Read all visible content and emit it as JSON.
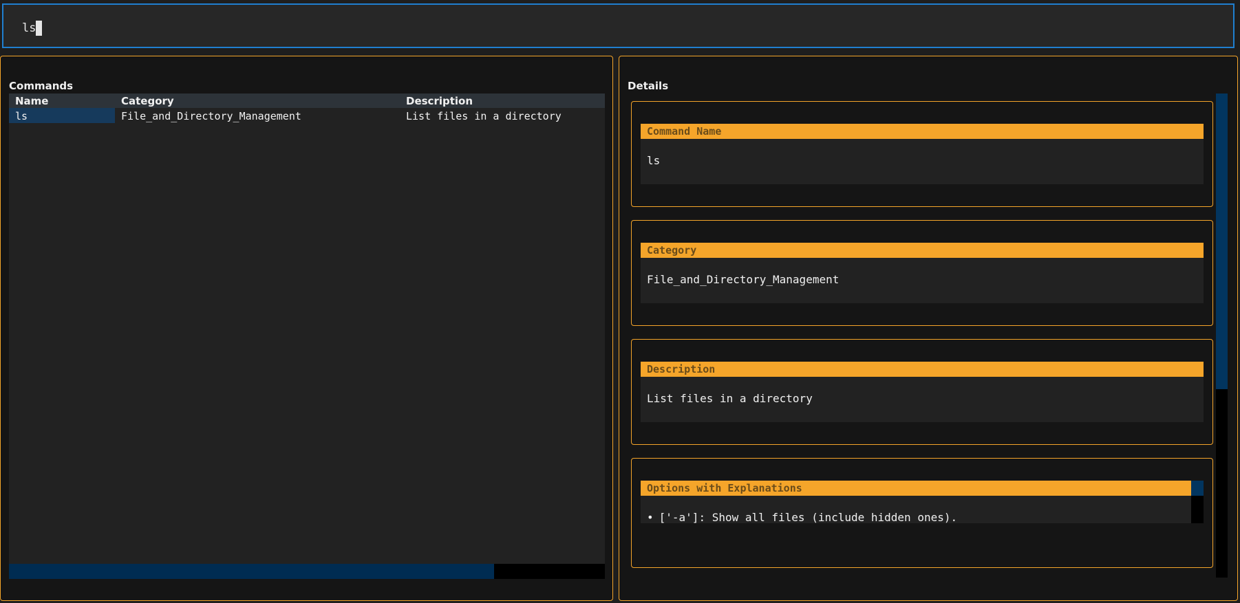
{
  "search": {
    "value": "ls"
  },
  "commands": {
    "title": "Commands",
    "columns": [
      "Name",
      "Category",
      "Description"
    ],
    "rows": [
      {
        "name": "ls",
        "category": "File_and_Directory_Management",
        "description": "List files in a directory"
      }
    ],
    "hscroll_fraction": 0.814
  },
  "details": {
    "title": "Details",
    "command_name": {
      "label": "Command Name",
      "value": "ls"
    },
    "category": {
      "label": "Category",
      "value": "File_and_Directory_Management"
    },
    "description": {
      "label": "Description",
      "value": "List files in a directory"
    },
    "options": {
      "label": "Options with Explanations",
      "items": [
        "['-a']: Show all files (include hidden ones)."
      ]
    }
  },
  "colors": {
    "accent": "#f5a52a",
    "focus_border": "#1f7fd0",
    "selection": "#163a5c",
    "scroll_thumb": "#02355f"
  }
}
